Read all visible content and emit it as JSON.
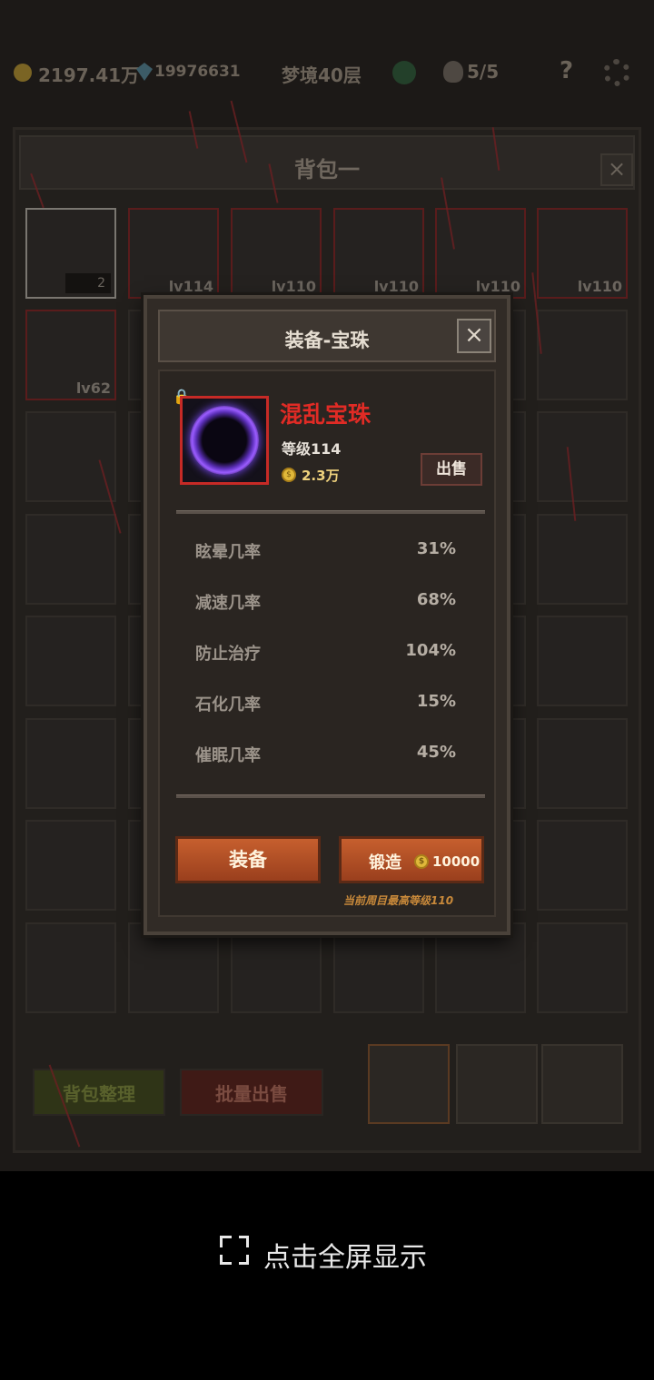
{
  "topbar": {
    "gold": "2197.41万",
    "gems": "19976631",
    "dream_level": "梦境40层",
    "kills": "5/5",
    "help": "?"
  },
  "bag": {
    "title": "背包一",
    "close": "×",
    "row1": [
      {
        "label": "2",
        "kind": "count"
      },
      {
        "label": "lv114",
        "kind": "level"
      },
      {
        "label": "lv110",
        "kind": "level"
      },
      {
        "label": "lv110",
        "kind": "level"
      },
      {
        "label": "lv110",
        "kind": "level"
      },
      {
        "label": "lv110",
        "kind": "level"
      }
    ],
    "row2": [
      {
        "label": "lv62",
        "kind": "level"
      }
    ],
    "sort_button": "背包整理",
    "bulk_sell_button": "批量出售"
  },
  "modal": {
    "title": "装备-宝珠",
    "close": "×",
    "item_name": "混乱宝珠",
    "item_level": "等级114",
    "item_price": "2.3万",
    "sell_button": "出售",
    "stats": [
      {
        "name": "眩晕几率",
        "value": "31%"
      },
      {
        "name": "减速几率",
        "value": "68%"
      },
      {
        "name": "防止治疗",
        "value": "104%"
      },
      {
        "name": "石化几率",
        "value": "15%"
      },
      {
        "name": "催眠几率",
        "value": "45%"
      }
    ],
    "equip_button": "装备",
    "forge_button": "锻造",
    "forge_cost": "10000",
    "max_level_note": "当前周目最高等级110",
    "colors": {
      "name": "#e02b25",
      "button": "#c65f2e"
    }
  },
  "fullscreen": {
    "label": "点击全屏显示",
    "icon": "expand-icon"
  }
}
